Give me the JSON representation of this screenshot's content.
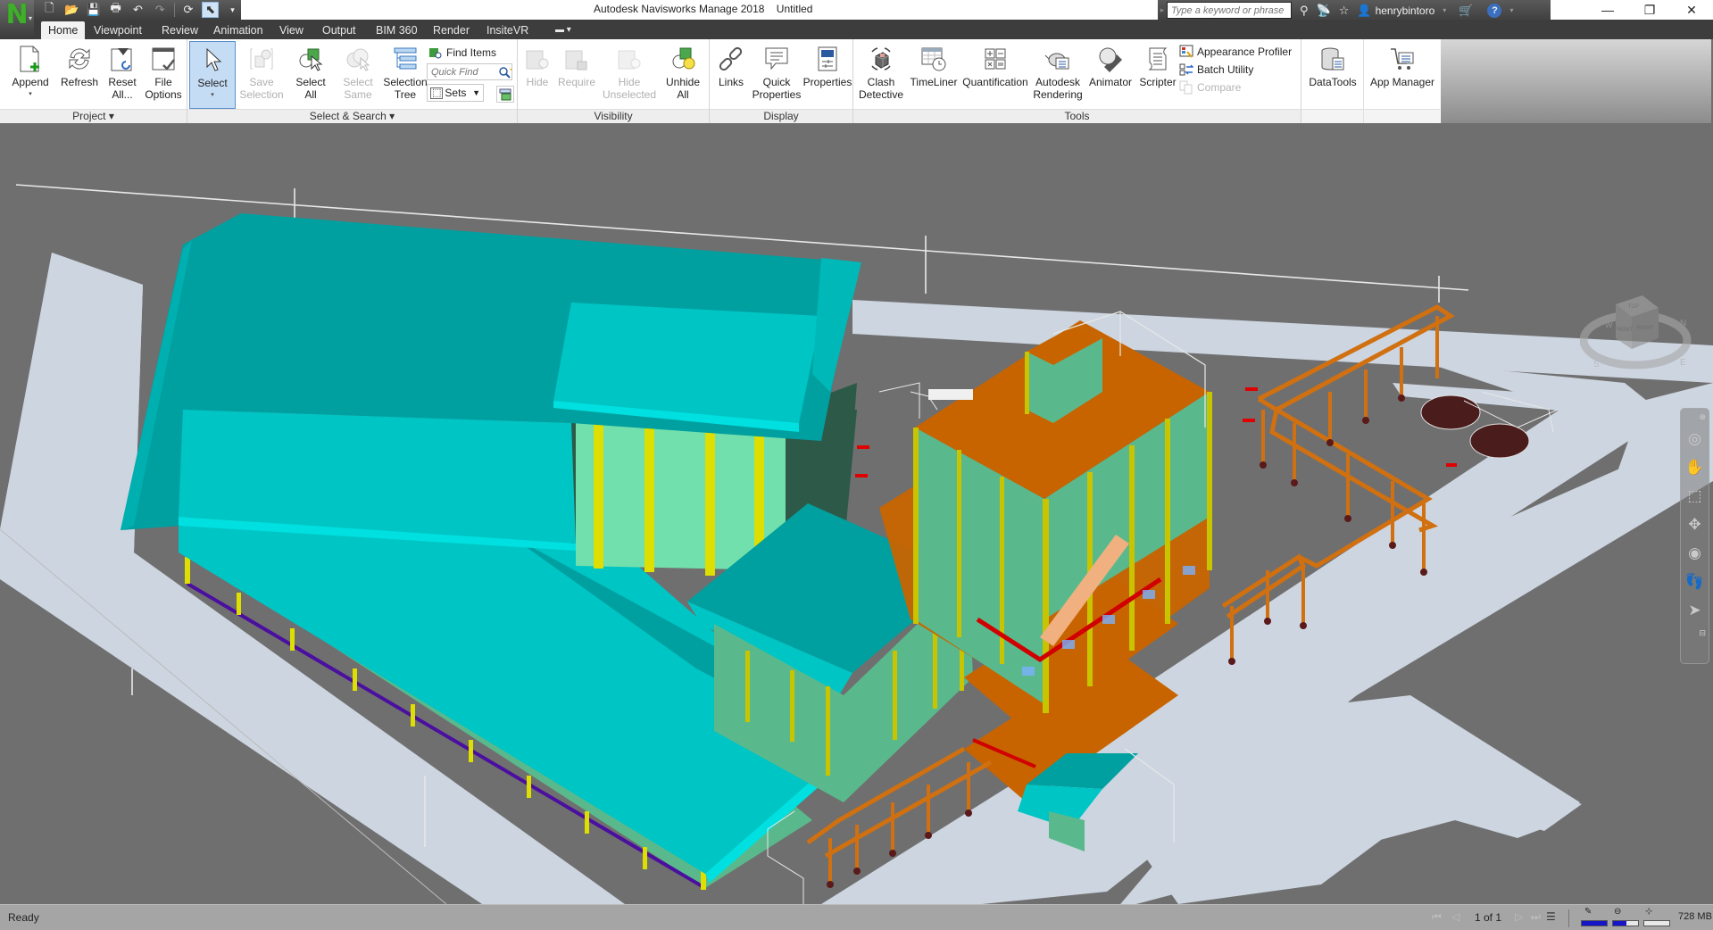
{
  "app": {
    "title": "Autodesk Navisworks Manage 2018",
    "document": "Untitled",
    "logo_letter": "N"
  },
  "quick_access": [
    {
      "name": "new-icon",
      "glyph": "🗋"
    },
    {
      "name": "open-icon",
      "glyph": "📂"
    },
    {
      "name": "save-icon",
      "glyph": "💾"
    },
    {
      "name": "print-icon",
      "glyph": "🖶"
    },
    {
      "name": "undo-icon",
      "glyph": "↶"
    },
    {
      "name": "redo-icon",
      "glyph": "↷"
    },
    {
      "name": "refresh-icon",
      "glyph": "⟳"
    },
    {
      "name": "select-icon",
      "glyph": "⬉"
    }
  ],
  "search": {
    "placeholder": "Type a keyword or phrase"
  },
  "user": {
    "name": "henrybintoro"
  },
  "window_controls": {
    "minimize": "—",
    "restore": "❐",
    "close": "✕"
  },
  "tabs": [
    {
      "label": "Home",
      "active": true
    },
    {
      "label": "Viewpoint"
    },
    {
      "label": "Review"
    },
    {
      "label": "Animation"
    },
    {
      "label": "View"
    },
    {
      "label": "Output"
    },
    {
      "label": "BIM 360"
    },
    {
      "label": "Render"
    },
    {
      "label": "InsiteVR"
    }
  ],
  "ribbon": {
    "panels": {
      "project": "Project ▾",
      "select_search": "Select & Search ▾",
      "visibility": "Visibility",
      "display": "Display",
      "tools": "Tools"
    },
    "project": {
      "append": [
        "Append",
        ""
      ],
      "refresh": [
        "Refresh",
        ""
      ],
      "reset_all": [
        "Reset",
        "All..."
      ],
      "file_options": [
        "File",
        "Options"
      ]
    },
    "select_search": {
      "select": [
        "Select",
        ""
      ],
      "save_selection": [
        "Save",
        "Selection"
      ],
      "select_all": [
        "Select",
        "All"
      ],
      "select_same": [
        "Select",
        "Same"
      ],
      "selection_tree": [
        "Selection",
        "Tree"
      ],
      "find_items": "Find Items",
      "quick_find_placeholder": "Quick Find",
      "sets": "Sets"
    },
    "visibility": {
      "hide": "Hide",
      "require": "Require",
      "hide_unselected": [
        "Hide",
        "Unselected"
      ],
      "unhide_all": [
        "Unhide",
        "All"
      ]
    },
    "display": {
      "links": "Links",
      "quick_properties": [
        "Quick",
        "Properties"
      ],
      "properties": "Properties"
    },
    "tools": {
      "clash_detective": [
        "Clash",
        "Detective"
      ],
      "timeliner": "TimeLiner",
      "quantification": "Quantification",
      "autodesk_rendering": [
        "Autodesk",
        "Rendering"
      ],
      "animator": "Animator",
      "scripter": "Scripter",
      "appearance_profiler": "Appearance Profiler",
      "batch_utility": "Batch Utility",
      "compare": "Compare"
    },
    "datatools": "DataTools",
    "app_manager": "App Manager"
  },
  "viewcube": {
    "top": "TOP",
    "front": "FRONT",
    "right": "RIGHT",
    "compass": [
      "N",
      "E",
      "S",
      "W"
    ]
  },
  "colors": {
    "ground": "#6f6f6f",
    "road": "#cdd5e0",
    "roof_dark": "#00a0a0",
    "roof_light": "#00c5c5",
    "roof_edge": "#00e0e0",
    "wall_green": "#72e0ac",
    "wall_green_dark": "#5ab98c",
    "wall_shadow": "#2d5a48",
    "column_yellow": "#dede00",
    "column_olive": "#c8c400",
    "steel_orange": "#c86400",
    "pipe_rack_orange": "#d07010",
    "footing": "#5a1a1a",
    "tank": "#4a1c1c",
    "base_purple": "#4b0fa0",
    "accent_red": "#e00000",
    "memory_bar": "#1616c8"
  },
  "status": {
    "text": "Ready",
    "page": "1 of 1",
    "memory": "728 MB",
    "meters": {
      "pencil_progress": 1.0,
      "disk_progress": 0.55,
      "network_progress": 0.0
    }
  }
}
